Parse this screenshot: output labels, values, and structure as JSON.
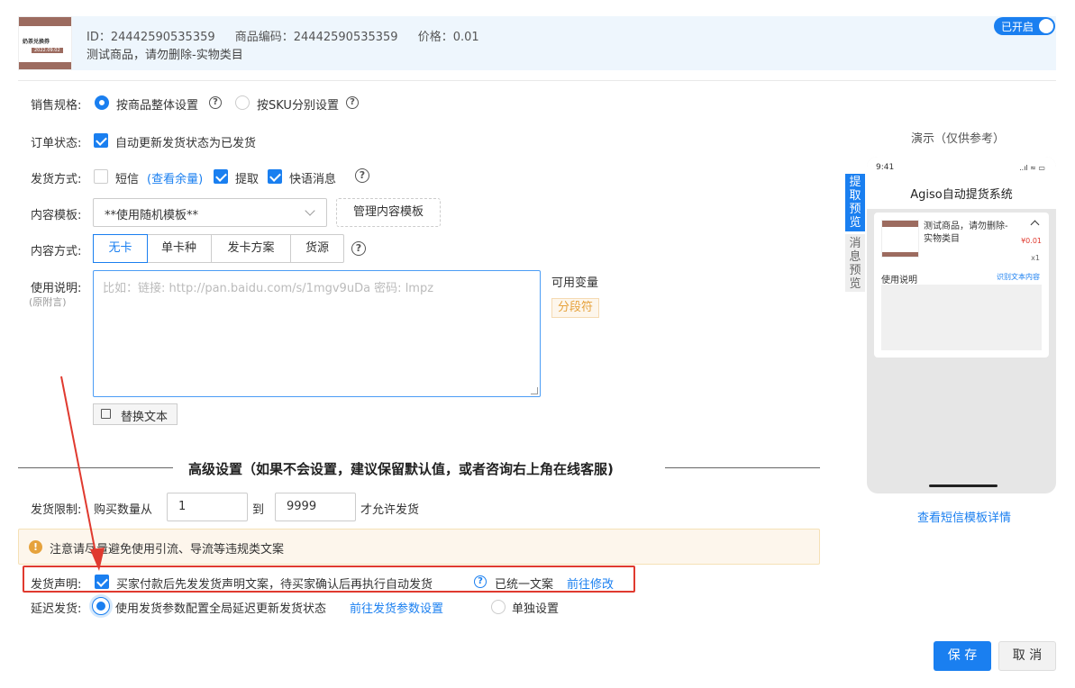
{
  "product": {
    "id_text": "ID：24442590535359",
    "code_text": "商品编码：24442590535359",
    "price_text": "价格：0.01",
    "name": "测试商品，请勿删除-实物类目",
    "thumb_title": "奶茶兑换券",
    "thumb_date": "2022.09.02",
    "toggle_label": "已开启"
  },
  "form": {
    "sales_spec": {
      "label": "销售规格:",
      "options": [
        "按商品整体设置",
        "按SKU分别设置"
      ],
      "selected": "按商品整体设置"
    },
    "order_status": {
      "label": "订单状态:",
      "checkbox_label": "自动更新发货状态为已发货",
      "checked": true
    },
    "delivery_method": {
      "label": "发货方式:",
      "sms_label": "短信",
      "sms_link": "(查看余量)",
      "options": [
        {
          "label": "短信",
          "checked": false
        },
        {
          "label": "提取",
          "checked": true
        },
        {
          "label": "快语消息",
          "checked": true
        }
      ]
    },
    "content_template": {
      "label": "内容模板:",
      "value": "**使用随机模板**",
      "manage_button": "管理内容模板"
    },
    "content_type": {
      "label": "内容方式:",
      "tabs": [
        "无卡",
        "单卡种",
        "发卡方案",
        "货源"
      ],
      "active": "无卡"
    },
    "usage": {
      "label": "使用说明:",
      "sub_label": "(原附言)",
      "placeholder": "比如：链接: http://pan.baidu.com/s/1mgv9uDa 密码: lmpz",
      "variables_label": "可用变量",
      "variable_tag": "分段符",
      "replace_button": "替换文本"
    }
  },
  "advanced": {
    "title": "高级设置（如果不会设置，建议保留默认值，或者咨询右上角在线客服)",
    "limit": {
      "label": "发货限制:",
      "prefix": "购买数量从",
      "min": "1",
      "to": "到",
      "max": "9999",
      "suffix": "才允许发货"
    },
    "warning": "注意请尽量避免使用引流、导流等违规类文案",
    "statement": {
      "label": "发货声明:",
      "checkbox_label": "买家付款后先发发货声明文案，待买家确认后再执行自动发货",
      "unified": "已统一文案",
      "link": "前往修改"
    },
    "delay": {
      "label": "延迟发货:",
      "option1": "使用发货参数配置全局延迟更新发货状态",
      "link": "前往发货参数设置",
      "option2": "单独设置"
    }
  },
  "preview": {
    "title": "演示（仅供参考）",
    "tab_active": "提取预览",
    "tab_inactive": "消息预览",
    "phone_time": "9:41",
    "phone_status": "..ıl ≈ ▭",
    "phone_title": "Agiso自动提货系统",
    "card_title": "测试商品，请勿删除-实物类目",
    "card_price": "¥0.01",
    "card_qty": "x1",
    "card_usage": "使用说明",
    "card_link": "识别文本内容",
    "sms_link": "查看短信模板详情"
  },
  "actions": {
    "save": "保 存",
    "cancel": "取 消"
  },
  "colors": {
    "primary": "#1a7ff0",
    "highlight": "#e03a2f",
    "warning": "#e6a23c"
  }
}
